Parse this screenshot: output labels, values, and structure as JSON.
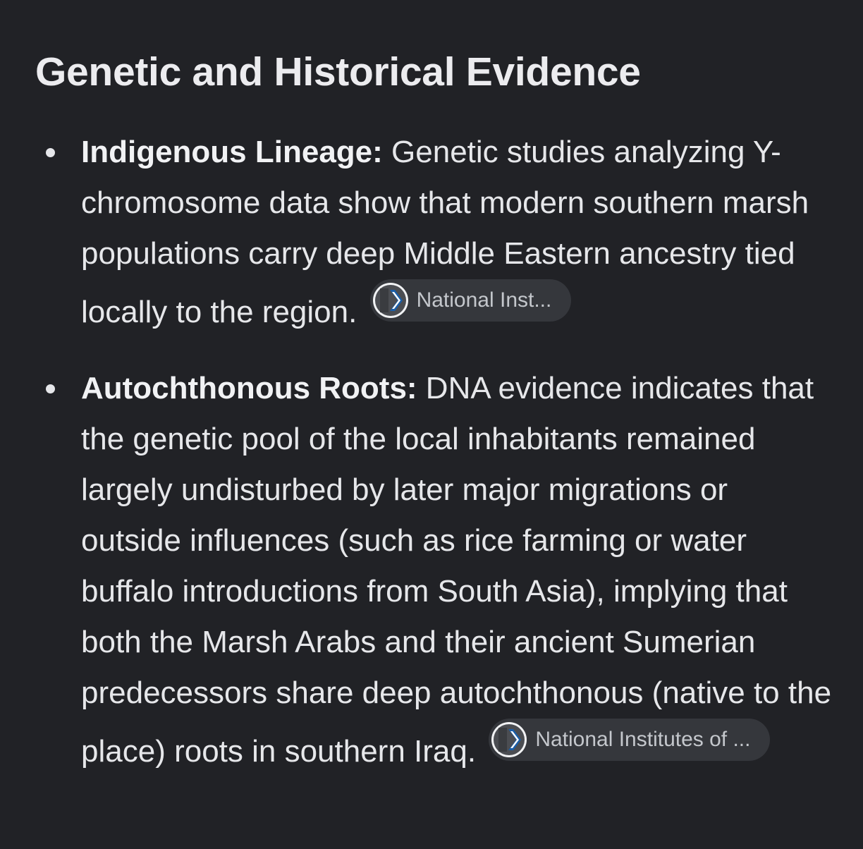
{
  "section": {
    "title": "Genetic and Historical Evidence"
  },
  "items": [
    {
      "term": "Indigenous Lineage:",
      "text": " Genetic studies analyzing Y-chromosome data show that modern southern marsh populations carry deep Middle Eastern ancestry tied locally to the region.",
      "source": {
        "label": "National Inst...",
        "icon": "ncbi-logo-icon"
      }
    },
    {
      "term": "Autochthonous Roots:",
      "text": " DNA evidence indicates that the genetic pool of the local inhabitants remained largely undisturbed by later major migrations or outside influences (such as rice farming or water buffalo introductions from South Asia), implying that both the Marsh Arabs and their ancient Sumerian predecessors share deep autochthonous (native to the place) roots in southern Iraq.",
      "source": {
        "label": "National Institutes of ...",
        "icon": "ncbi-logo-icon"
      }
    }
  ],
  "colors": {
    "background": "#212226",
    "text": "#e6e7ea",
    "chip_background": "#35373c",
    "icon_accent": "#1a5ea8"
  }
}
